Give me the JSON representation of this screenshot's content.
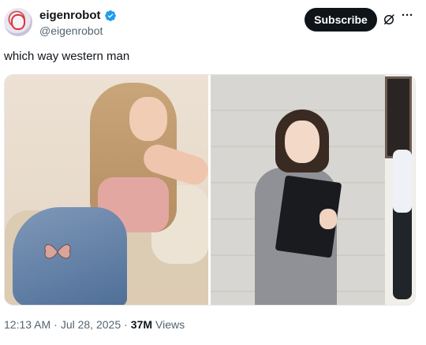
{
  "author": {
    "display_name": "eigenrobot",
    "handle": "@eigenrobot"
  },
  "actions": {
    "subscribe_label": "Subscribe"
  },
  "tweet": {
    "text": "which way western man"
  },
  "meta": {
    "time": "12:13 AM",
    "sep1": "·",
    "date": "Jul 28, 2025",
    "sep2": "·",
    "views_count": "37M",
    "views_label": "Views"
  },
  "colors": {
    "verified": "#1d9bf0",
    "subscribe_bg": "#0f1419",
    "secondary_text": "#536471"
  },
  "icons": [
    "verified-badge-icon",
    "grok-icon",
    "more-icon"
  ]
}
